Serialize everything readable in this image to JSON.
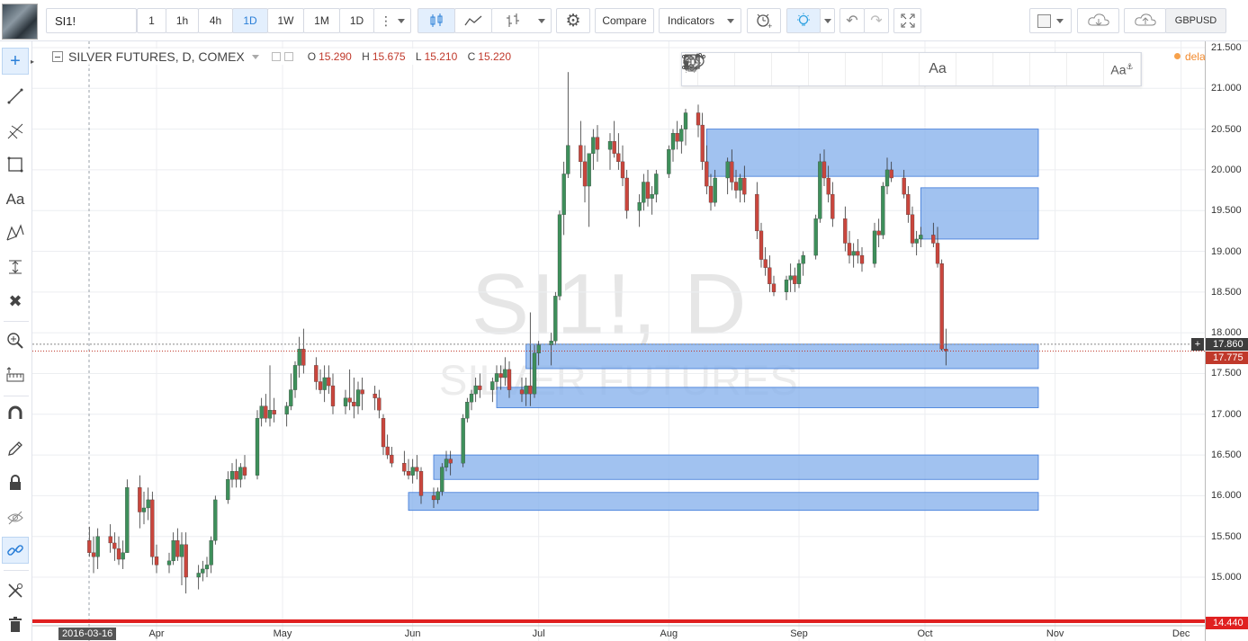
{
  "toolbar": {
    "symbol": "SI1!",
    "intervals": [
      "1",
      "1h",
      "4h",
      "1D",
      "1W",
      "1M",
      "1D"
    ],
    "active_interval": "1D",
    "compare_label": "Compare",
    "indicators_label": "Indicators",
    "currency": "GBPUSD"
  },
  "legend": {
    "title": "SILVER FUTURES, D, COMEX",
    "o_label": "O",
    "o_value": "15.290",
    "h_label": "H",
    "h_value": "15.675",
    "l_label": "L",
    "l_value": "15.210",
    "c_label": "C",
    "c_value": "15.220",
    "delayed": "delayed"
  },
  "watermark": {
    "symbol": "SI1!, D",
    "name": "SILVER FUTURES"
  },
  "price_axis": {
    "ticks": [
      "21.500",
      "21.000",
      "20.500",
      "20.000",
      "19.500",
      "19.000",
      "18.500",
      "18.000",
      "17.500",
      "17.000",
      "16.500",
      "16.000",
      "15.500",
      "15.000"
    ],
    "current_price": "17.860",
    "last_price": "17.775",
    "low_line_price": "14.440"
  },
  "time_axis": {
    "start_label": "2016-03-16",
    "months": [
      "Apr",
      "May",
      "Jun",
      "Jul",
      "Aug",
      "Sep",
      "Oct",
      "Nov",
      "Dec"
    ]
  },
  "colors": {
    "up": "#3e8f5b",
    "down": "#c9463d",
    "zone_fill": "#8ab3ec",
    "zone_stroke": "#3c78d8",
    "accent": "#2a7fd8",
    "delayed": "#f28a2e"
  },
  "chart_data": {
    "type": "candlestick",
    "title": "SILVER FUTURES, D, COMEX",
    "ylim": [
      14.44,
      21.6
    ],
    "support_resistance_zones": [
      {
        "from": "2016-08-10",
        "to": "2016-10-28",
        "low": 19.92,
        "high": 20.5
      },
      {
        "from": "2016-09-30",
        "to": "2016-10-28",
        "low": 19.15,
        "high": 19.78
      },
      {
        "from": "2016-06-28",
        "to": "2016-10-28",
        "low": 17.56,
        "high": 17.86
      },
      {
        "from": "2016-06-21",
        "to": "2016-10-28",
        "low": 17.08,
        "high": 17.33
      },
      {
        "from": "2016-06-06",
        "to": "2016-10-28",
        "low": 16.2,
        "high": 16.5
      },
      {
        "from": "2016-05-31",
        "to": "2016-10-28",
        "low": 15.82,
        "high": 16.04
      }
    ],
    "candles": [
      {
        "o": 15.45,
        "h": 15.62,
        "l": 15.25,
        "c": 15.3
      },
      {
        "o": 15.3,
        "h": 15.5,
        "l": 15.05,
        "c": 15.25
      },
      {
        "o": 15.25,
        "h": 15.6,
        "l": 15.1,
        "c": 15.5
      },
      {
        "o": 15.5,
        "h": 15.65,
        "l": 15.3,
        "c": 15.42
      },
      {
        "o": 15.42,
        "h": 15.55,
        "l": 15.2,
        "c": 15.35
      },
      {
        "o": 15.35,
        "h": 15.5,
        "l": 15.15,
        "c": 15.22
      },
      {
        "o": 15.22,
        "h": 15.45,
        "l": 15.1,
        "c": 15.3
      },
      {
        "o": 15.3,
        "h": 16.2,
        "l": 15.3,
        "c": 16.1
      },
      {
        "o": 16.1,
        "h": 16.25,
        "l": 15.6,
        "c": 15.8
      },
      {
        "o": 15.8,
        "h": 16.05,
        "l": 15.65,
        "c": 15.85
      },
      {
        "o": 15.85,
        "h": 16.1,
        "l": 15.7,
        "c": 15.95
      },
      {
        "o": 15.95,
        "h": 16.05,
        "l": 15.15,
        "c": 15.25
      },
      {
        "o": 15.25,
        "h": 15.4,
        "l": 15.05,
        "c": 15.15
      },
      {
        "o": 15.15,
        "h": 15.3,
        "l": 15.05,
        "c": 15.2
      },
      {
        "o": 15.2,
        "h": 15.55,
        "l": 15.15,
        "c": 15.45
      },
      {
        "o": 15.45,
        "h": 15.6,
        "l": 15.2,
        "c": 15.25
      },
      {
        "o": 15.25,
        "h": 15.55,
        "l": 14.9,
        "c": 15.4
      },
      {
        "o": 15.4,
        "h": 15.55,
        "l": 14.8,
        "c": 15.0
      },
      {
        "o": 15.0,
        "h": 15.15,
        "l": 14.85,
        "c": 15.05
      },
      {
        "o": 15.05,
        "h": 15.2,
        "l": 14.95,
        "c": 15.1
      },
      {
        "o": 15.1,
        "h": 15.25,
        "l": 15.0,
        "c": 15.15
      },
      {
        "o": 15.15,
        "h": 15.5,
        "l": 15.05,
        "c": 15.45
      },
      {
        "o": 15.45,
        "h": 16.0,
        "l": 15.4,
        "c": 15.95
      },
      {
        "o": 15.95,
        "h": 16.3,
        "l": 15.9,
        "c": 16.2
      },
      {
        "o": 16.2,
        "h": 16.4,
        "l": 16.1,
        "c": 16.3
      },
      {
        "o": 16.3,
        "h": 16.45,
        "l": 16.1,
        "c": 16.2
      },
      {
        "o": 16.2,
        "h": 16.4,
        "l": 16.1,
        "c": 16.35
      },
      {
        "o": 16.35,
        "h": 16.5,
        "l": 16.2,
        "c": 16.25
      },
      {
        "o": 16.25,
        "h": 17.05,
        "l": 16.2,
        "c": 16.95
      },
      {
        "o": 16.95,
        "h": 17.2,
        "l": 16.85,
        "c": 17.1
      },
      {
        "o": 17.1,
        "h": 17.25,
        "l": 16.9,
        "c": 16.95
      },
      {
        "o": 16.95,
        "h": 17.6,
        "l": 16.85,
        "c": 17.05
      },
      {
        "o": 17.05,
        "h": 17.2,
        "l": 16.9,
        "c": 17.0
      },
      {
        "o": 17.0,
        "h": 17.15,
        "l": 16.85,
        "c": 17.1
      },
      {
        "o": 17.1,
        "h": 17.5,
        "l": 17.05,
        "c": 17.3
      },
      {
        "o": 17.3,
        "h": 17.65,
        "l": 17.2,
        "c": 17.6
      },
      {
        "o": 17.6,
        "h": 17.95,
        "l": 17.45,
        "c": 17.8
      },
      {
        "o": 17.8,
        "h": 18.05,
        "l": 17.5,
        "c": 17.6
      },
      {
        "o": 17.6,
        "h": 17.7,
        "l": 17.3,
        "c": 17.4
      },
      {
        "o": 17.4,
        "h": 17.55,
        "l": 17.25,
        "c": 17.3
      },
      {
        "o": 17.3,
        "h": 17.6,
        "l": 17.15,
        "c": 17.45
      },
      {
        "o": 17.45,
        "h": 17.6,
        "l": 17.25,
        "c": 17.35
      },
      {
        "o": 17.35,
        "h": 17.5,
        "l": 17.0,
        "c": 17.1
      },
      {
        "o": 17.1,
        "h": 17.3,
        "l": 17.0,
        "c": 17.2
      },
      {
        "o": 17.2,
        "h": 17.55,
        "l": 17.05,
        "c": 17.15
      },
      {
        "o": 17.15,
        "h": 17.45,
        "l": 16.95,
        "c": 17.1
      },
      {
        "o": 17.1,
        "h": 17.4,
        "l": 17.0,
        "c": 17.3
      },
      {
        "o": 17.3,
        "h": 17.45,
        "l": 17.05,
        "c": 17.25
      },
      {
        "o": 17.25,
        "h": 17.35,
        "l": 17.05,
        "c": 17.2
      },
      {
        "o": 17.2,
        "h": 17.3,
        "l": 16.95,
        "c": 17.05
      },
      {
        "o": 16.95,
        "h": 17.0,
        "l": 16.5,
        "c": 16.6
      },
      {
        "o": 16.6,
        "h": 16.75,
        "l": 16.45,
        "c": 16.5
      },
      {
        "o": 16.5,
        "h": 16.6,
        "l": 16.35,
        "c": 16.4
      },
      {
        "o": 16.4,
        "h": 16.55,
        "l": 16.25,
        "c": 16.3
      },
      {
        "o": 16.3,
        "h": 16.45,
        "l": 16.2,
        "c": 16.25
      },
      {
        "o": 16.25,
        "h": 16.45,
        "l": 16.15,
        "c": 16.35
      },
      {
        "o": 16.35,
        "h": 16.5,
        "l": 16.2,
        "c": 16.3
      },
      {
        "o": 16.3,
        "h": 16.35,
        "l": 15.9,
        "c": 16.0
      },
      {
        "o": 16.0,
        "h": 16.1,
        "l": 15.85,
        "c": 15.95
      },
      {
        "o": 15.95,
        "h": 16.1,
        "l": 15.9,
        "c": 16.05
      },
      {
        "o": 16.05,
        "h": 16.4,
        "l": 16.0,
        "c": 16.35
      },
      {
        "o": 16.35,
        "h": 16.55,
        "l": 16.3,
        "c": 16.45
      },
      {
        "o": 16.45,
        "h": 16.55,
        "l": 16.25,
        "c": 16.4
      },
      {
        "o": 16.4,
        "h": 17.0,
        "l": 16.35,
        "c": 16.95
      },
      {
        "o": 16.95,
        "h": 17.2,
        "l": 16.9,
        "c": 17.15
      },
      {
        "o": 17.15,
        "h": 17.3,
        "l": 17.05,
        "c": 17.25
      },
      {
        "o": 17.25,
        "h": 17.45,
        "l": 17.15,
        "c": 17.35
      },
      {
        "o": 17.35,
        "h": 17.5,
        "l": 17.2,
        "c": 17.3
      },
      {
        "o": 17.3,
        "h": 17.45,
        "l": 17.15,
        "c": 17.4
      },
      {
        "o": 17.4,
        "h": 17.6,
        "l": 17.3,
        "c": 17.5
      },
      {
        "o": 17.5,
        "h": 17.6,
        "l": 17.3,
        "c": 17.45
      },
      {
        "o": 17.45,
        "h": 17.7,
        "l": 17.35,
        "c": 17.55
      },
      {
        "o": 17.55,
        "h": 17.65,
        "l": 17.2,
        "c": 17.3
      },
      {
        "o": 17.3,
        "h": 17.45,
        "l": 17.15,
        "c": 17.25
      },
      {
        "o": 17.25,
        "h": 17.45,
        "l": 17.1,
        "c": 17.35
      },
      {
        "o": 17.35,
        "h": 18.25,
        "l": 17.1,
        "c": 17.25
      },
      {
        "o": 17.25,
        "h": 17.85,
        "l": 17.2,
        "c": 17.75
      },
      {
        "o": 17.75,
        "h": 17.9,
        "l": 17.6,
        "c": 17.85
      },
      {
        "o": 17.85,
        "h": 18.0,
        "l": 17.6,
        "c": 17.9
      },
      {
        "o": 17.9,
        "h": 18.5,
        "l": 17.85,
        "c": 18.45
      },
      {
        "o": 18.45,
        "h": 19.5,
        "l": 18.4,
        "c": 19.45
      },
      {
        "o": 19.45,
        "h": 20.1,
        "l": 19.2,
        "c": 19.95
      },
      {
        "o": 19.95,
        "h": 21.2,
        "l": 19.9,
        "c": 20.3
      },
      {
        "o": 20.3,
        "h": 20.6,
        "l": 19.9,
        "c": 20.1
      },
      {
        "o": 20.1,
        "h": 20.3,
        "l": 19.6,
        "c": 19.8
      },
      {
        "o": 19.8,
        "h": 20.2,
        "l": 19.3,
        "c": 20.2
      },
      {
        "o": 20.2,
        "h": 20.5,
        "l": 20.0,
        "c": 20.4
      },
      {
        "o": 20.4,
        "h": 20.55,
        "l": 20.1,
        "c": 20.25
      },
      {
        "o": 20.25,
        "h": 20.45,
        "l": 20.0,
        "c": 20.35
      },
      {
        "o": 20.35,
        "h": 20.6,
        "l": 20.15,
        "c": 20.2
      },
      {
        "o": 20.2,
        "h": 20.45,
        "l": 20.0,
        "c": 20.1
      },
      {
        "o": 20.1,
        "h": 20.3,
        "l": 19.8,
        "c": 19.9
      },
      {
        "o": 19.9,
        "h": 20.0,
        "l": 19.4,
        "c": 19.5
      },
      {
        "o": 19.5,
        "h": 19.7,
        "l": 19.3,
        "c": 19.6
      },
      {
        "o": 19.6,
        "h": 19.95,
        "l": 19.5,
        "c": 19.85
      },
      {
        "o": 19.85,
        "h": 20.0,
        "l": 19.55,
        "c": 19.65
      },
      {
        "o": 19.65,
        "h": 19.8,
        "l": 19.45,
        "c": 19.7
      },
      {
        "o": 19.7,
        "h": 20.0,
        "l": 19.6,
        "c": 19.95
      },
      {
        "o": 19.95,
        "h": 20.3,
        "l": 19.9,
        "c": 20.25
      },
      {
        "o": 20.25,
        "h": 20.5,
        "l": 20.1,
        "c": 20.45
      },
      {
        "o": 20.45,
        "h": 20.6,
        "l": 20.25,
        "c": 20.35
      },
      {
        "o": 20.35,
        "h": 20.55,
        "l": 20.2,
        "c": 20.5
      },
      {
        "o": 20.5,
        "h": 20.75,
        "l": 20.3,
        "c": 20.7
      },
      {
        "o": 20.7,
        "h": 20.8,
        "l": 20.4,
        "c": 20.55
      },
      {
        "o": 20.55,
        "h": 20.7,
        "l": 20.0,
        "c": 20.1
      },
      {
        "o": 20.1,
        "h": 20.3,
        "l": 19.7,
        "c": 19.8
      },
      {
        "o": 19.8,
        "h": 19.95,
        "l": 19.5,
        "c": 19.6
      },
      {
        "o": 19.6,
        "h": 20.0,
        "l": 19.55,
        "c": 19.9
      },
      {
        "o": 19.9,
        "h": 20.15,
        "l": 19.7,
        "c": 20.1
      },
      {
        "o": 20.1,
        "h": 20.25,
        "l": 19.75,
        "c": 19.85
      },
      {
        "o": 19.85,
        "h": 20.0,
        "l": 19.65,
        "c": 19.75
      },
      {
        "o": 19.75,
        "h": 19.95,
        "l": 19.6,
        "c": 19.9
      },
      {
        "o": 19.9,
        "h": 20.05,
        "l": 19.6,
        "c": 19.7
      },
      {
        "o": 19.7,
        "h": 19.85,
        "l": 19.15,
        "c": 19.25
      },
      {
        "o": 19.25,
        "h": 19.35,
        "l": 18.8,
        "c": 18.9
      },
      {
        "o": 18.9,
        "h": 19.05,
        "l": 18.7,
        "c": 18.8
      },
      {
        "o": 18.8,
        "h": 18.95,
        "l": 18.5,
        "c": 18.6
      },
      {
        "o": 18.6,
        "h": 18.7,
        "l": 18.45,
        "c": 18.5
      },
      {
        "o": 18.5,
        "h": 18.7,
        "l": 18.4,
        "c": 18.65
      },
      {
        "o": 18.65,
        "h": 18.85,
        "l": 18.5,
        "c": 18.7
      },
      {
        "o": 18.7,
        "h": 18.8,
        "l": 18.5,
        "c": 18.6
      },
      {
        "o": 18.6,
        "h": 18.9,
        "l": 18.55,
        "c": 18.85
      },
      {
        "o": 18.85,
        "h": 19.0,
        "l": 18.7,
        "c": 18.95
      },
      {
        "o": 18.95,
        "h": 19.45,
        "l": 18.9,
        "c": 19.4
      },
      {
        "o": 19.4,
        "h": 20.2,
        "l": 19.35,
        "c": 20.1
      },
      {
        "o": 20.1,
        "h": 20.25,
        "l": 19.8,
        "c": 19.9
      },
      {
        "o": 19.9,
        "h": 20.05,
        "l": 19.6,
        "c": 19.7
      },
      {
        "o": 19.7,
        "h": 19.85,
        "l": 19.3,
        "c": 19.4
      },
      {
        "o": 19.4,
        "h": 19.55,
        "l": 19.0,
        "c": 19.1
      },
      {
        "o": 19.1,
        "h": 19.25,
        "l": 18.85,
        "c": 18.95
      },
      {
        "o": 18.95,
        "h": 19.1,
        "l": 18.8,
        "c": 19.0
      },
      {
        "o": 19.0,
        "h": 19.15,
        "l": 18.85,
        "c": 18.95
      },
      {
        "o": 18.95,
        "h": 19.05,
        "l": 18.75,
        "c": 18.85
      },
      {
        "o": 18.85,
        "h": 19.35,
        "l": 18.8,
        "c": 19.25
      },
      {
        "o": 19.25,
        "h": 19.4,
        "l": 19.05,
        "c": 19.2
      },
      {
        "o": 19.2,
        "h": 19.85,
        "l": 19.15,
        "c": 19.8
      },
      {
        "o": 19.8,
        "h": 20.15,
        "l": 19.7,
        "c": 20.0
      },
      {
        "o": 20.0,
        "h": 20.1,
        "l": 19.85,
        "c": 19.9
      },
      {
        "o": 19.9,
        "h": 20.0,
        "l": 19.65,
        "c": 19.7
      },
      {
        "o": 19.7,
        "h": 19.8,
        "l": 19.35,
        "c": 19.45
      },
      {
        "o": 19.45,
        "h": 19.55,
        "l": 19.05,
        "c": 19.1
      },
      {
        "o": 19.1,
        "h": 19.25,
        "l": 18.95,
        "c": 19.15
      },
      {
        "o": 19.15,
        "h": 19.3,
        "l": 19.05,
        "c": 19.2
      },
      {
        "o": 19.2,
        "h": 19.35,
        "l": 19.05,
        "c": 19.1
      },
      {
        "o": 19.1,
        "h": 19.3,
        "l": 18.8,
        "c": 18.85
      },
      {
        "o": 18.85,
        "h": 18.9,
        "l": 17.78,
        "c": 17.8
      },
      {
        "o": 17.8,
        "h": 18.05,
        "l": 17.6,
        "c": 17.78
      }
    ]
  }
}
